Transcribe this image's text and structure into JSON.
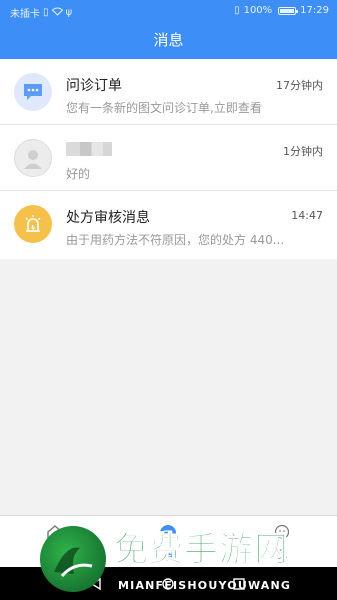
{
  "status_bar": {
    "carrier": "未插卡",
    "battery": "100%",
    "time": "17:29"
  },
  "header": {
    "title": "消息"
  },
  "messages": [
    {
      "title": "问诊订单",
      "time": "17分钟内",
      "preview": "您有一条新的图文问诊订单,立即查看",
      "icon": "chat-bubble-icon",
      "icon_color": "#5c9cf5"
    },
    {
      "title": "",
      "time": "1分钟内",
      "preview": "好的",
      "icon": "user-avatar-icon",
      "icon_color": "#e6e6e6"
    },
    {
      "title": "处方审核消息",
      "time": "14:47",
      "preview": "由于用药方法不符原因，您的处方 440...",
      "icon": "alarm-light-icon",
      "icon_color": "#f5c14a"
    }
  ],
  "tabbar": {
    "tabs": [
      {
        "label": "",
        "icon": "home-icon"
      },
      {
        "label": "消",
        "icon": "message-icon",
        "active": true
      },
      {
        "label": "我",
        "icon": "profile-icon"
      }
    ]
  },
  "watermark": {
    "text": "免费手游网",
    "sub": "MIANFEISHOUYOUWANG"
  }
}
